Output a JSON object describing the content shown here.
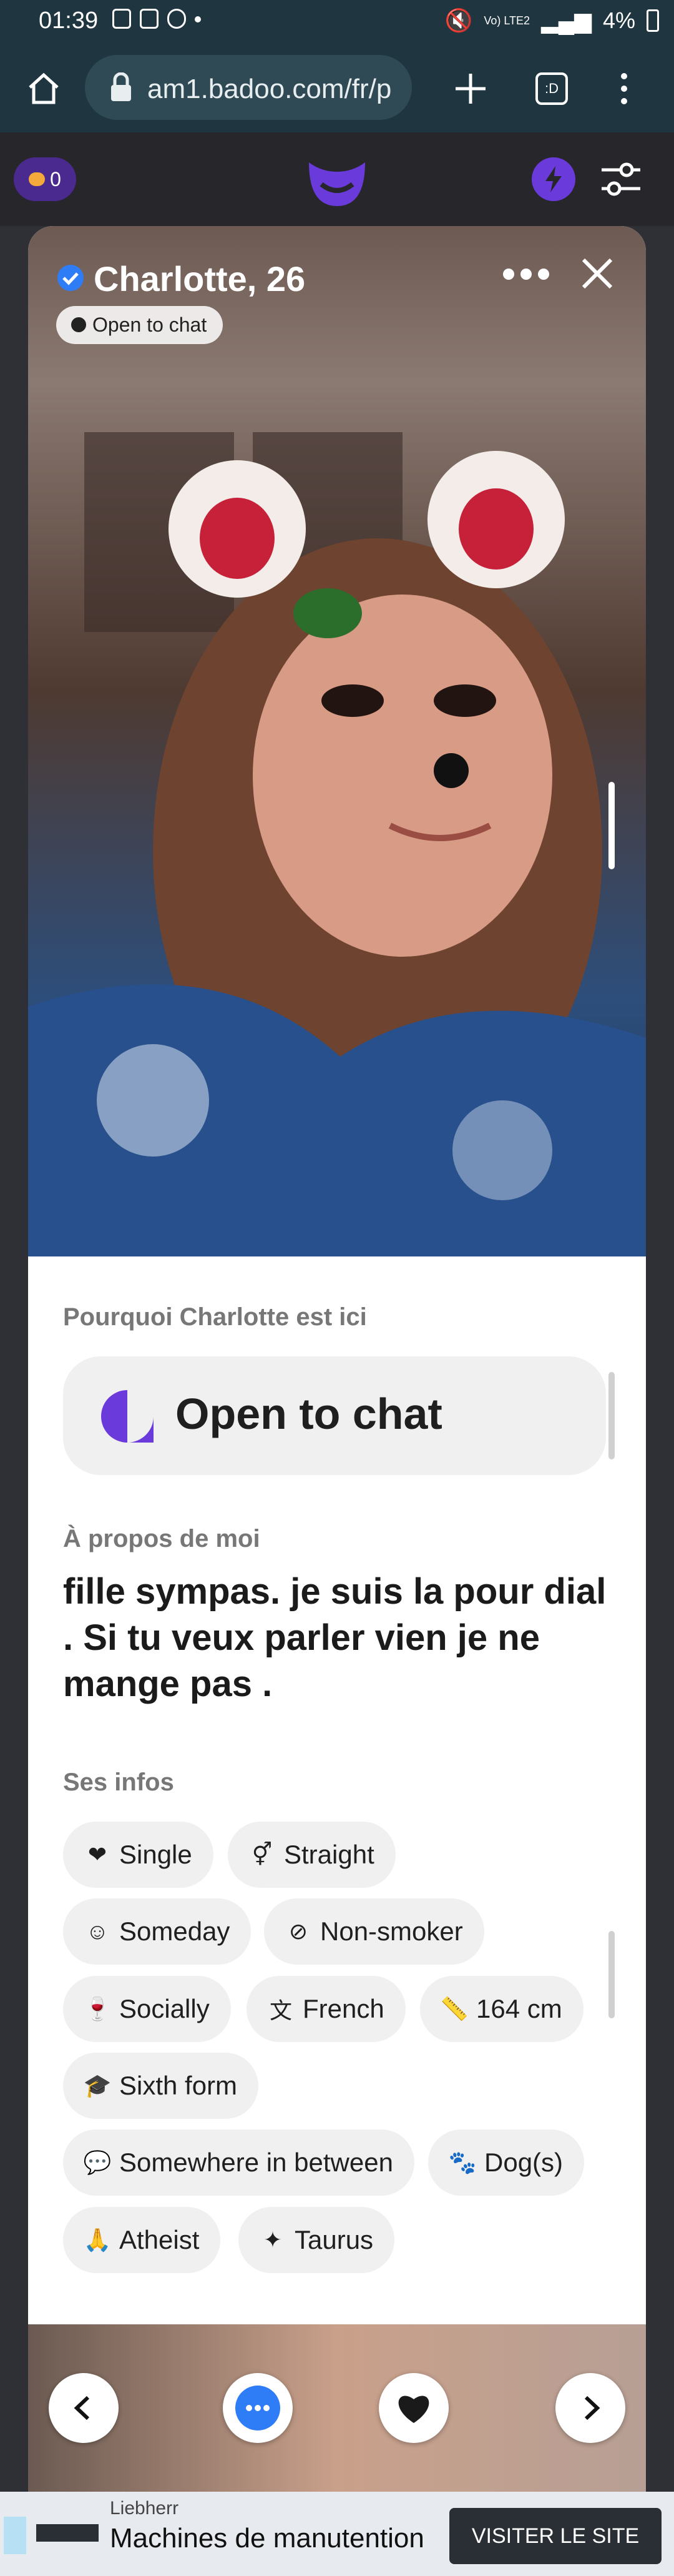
{
  "status": {
    "time": "01:39",
    "battery": "4%",
    "network": "Vo) LTE2"
  },
  "browser": {
    "url": "am1.badoo.com/fr/p",
    "tab_count": ":D"
  },
  "app": {
    "messages_count": "0"
  },
  "profile": {
    "name": "Charlotte, 26",
    "badge": "Open to chat",
    "why_title": "Pourquoi Charlotte est ici",
    "why_value": "Open to chat",
    "about_title": "À propos de moi",
    "about_text": "fille sympas. je suis la pour dial . Si tu veux parler vien je ne mange pas .",
    "infos_title": "Ses infos",
    "tags": [
      {
        "label": "Single",
        "icon": "heart-icon"
      },
      {
        "label": "Straight",
        "icon": "gender-icon"
      },
      {
        "label": "Someday",
        "icon": "baby-icon"
      },
      {
        "label": "Non-smoker",
        "icon": "no-smoking-icon"
      },
      {
        "label": "Socially",
        "icon": "wine-glass-icon"
      },
      {
        "label": "French",
        "icon": "translate-icon"
      },
      {
        "label": "164 cm",
        "icon": "ruler-icon"
      },
      {
        "label": "Sixth form",
        "icon": "graduation-cap-icon"
      },
      {
        "label": "Somewhere in between",
        "icon": "speech-bubble-icon"
      },
      {
        "label": "Dog(s)",
        "icon": "paw-icon"
      },
      {
        "label": "Atheist",
        "icon": "hands-icon"
      },
      {
        "label": "Taurus",
        "icon": "constellation-icon"
      }
    ]
  },
  "ad": {
    "sponsor": "Liebherr",
    "title": "Machines de manutention",
    "cta": "VISITER LE SITE"
  }
}
